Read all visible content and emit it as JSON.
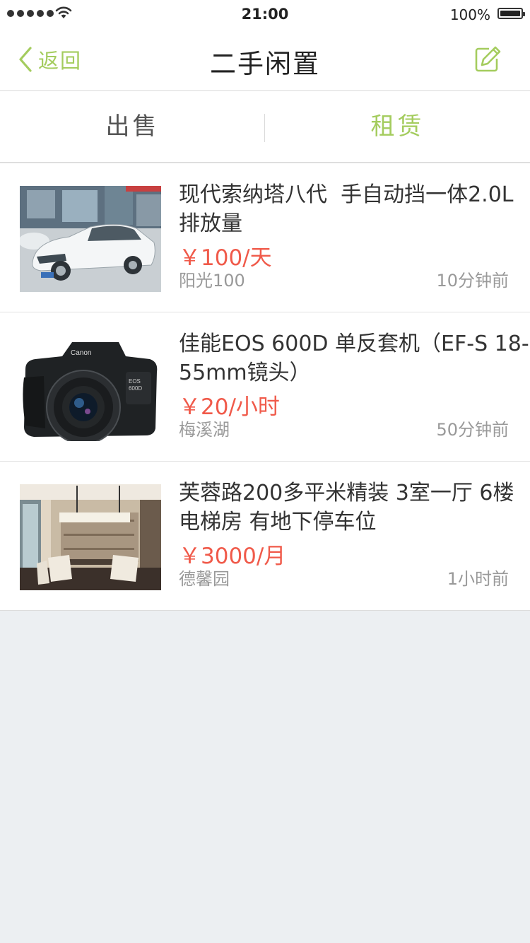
{
  "status_bar": {
    "time": "21:00",
    "battery_percent": "100%",
    "signal_dots": 5
  },
  "nav": {
    "back_label": "返回",
    "title": "二手闲置",
    "edit_icon": "edit-icon"
  },
  "tabs": [
    {
      "label": "出售",
      "active": false
    },
    {
      "label": "租赁",
      "active": true
    }
  ],
  "colors": {
    "accent": "#A4CC5E",
    "price": "#F05A4A",
    "background": "#ECEFF2"
  },
  "items": [
    {
      "title": "现代索纳塔八代  手自动挡一体2.0L排放量",
      "price": "￥100/天",
      "location": "阳光100",
      "time": "10分钟前",
      "image": "car-photo"
    },
    {
      "title": "佳能EOS 600D 单反套机（EF-S 18-55mm镜头）",
      "price": "￥20/小时",
      "location": "梅溪湖",
      "time": "50分钟前",
      "image": "camera-photo"
    },
    {
      "title": "芙蓉路200多平米精装 3室一厅 6楼电梯房 有地下停车位",
      "price": "￥3000/月",
      "location": "德馨园",
      "time": "1小时前",
      "image": "room-photo"
    }
  ]
}
